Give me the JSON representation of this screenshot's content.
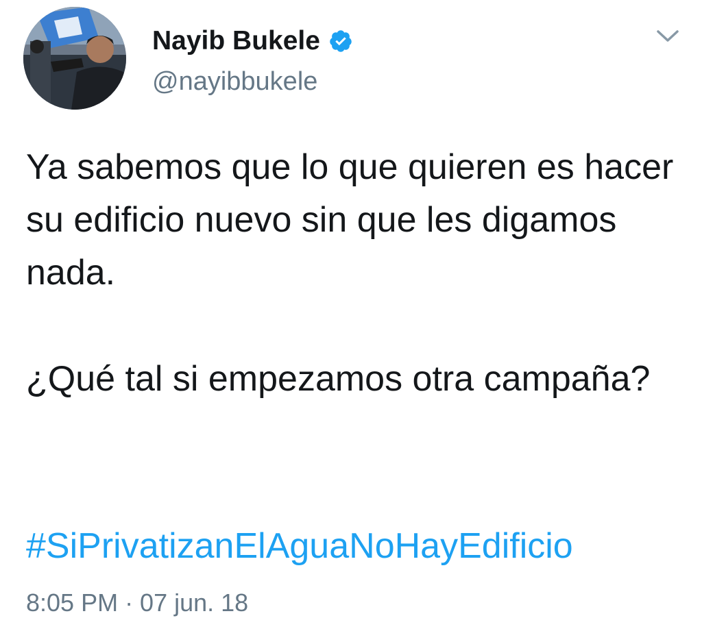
{
  "tweet": {
    "author": {
      "display_name": "Nayib Bukele",
      "handle": "@nayibbukele",
      "verified": true,
      "verified_color": "#1da1f2"
    },
    "text_paragraphs": [
      "Ya sabemos que lo que quieren es hacer su edificio nuevo sin que les digamos nada.",
      "¿Qué tal si empezamos otra campaña?"
    ],
    "hashtag": "#SiPrivatizanElAguaNoHayEdificio",
    "timestamp": "8:05 PM · 07 jun. 18",
    "colors": {
      "text": "#14171a",
      "secondary": "#657786",
      "link": "#1da1f2",
      "background": "#ffffff"
    },
    "icons": {
      "verified": "verified-badge-icon",
      "more": "chevron-down-icon"
    }
  }
}
